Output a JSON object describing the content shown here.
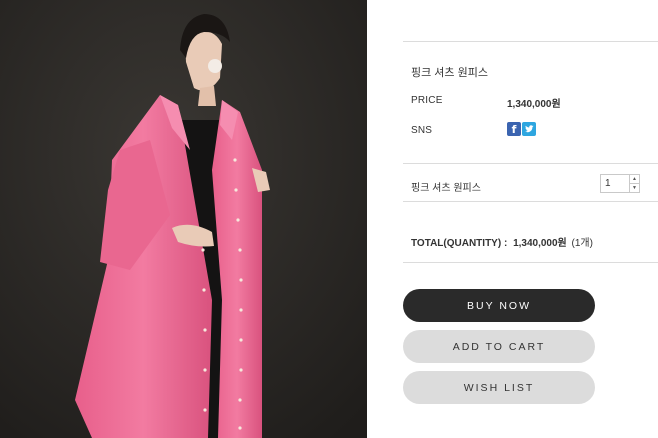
{
  "product": {
    "name": "핑크 셔츠 원피스",
    "price_label": "PRICE",
    "price_value": "1,340,000원",
    "sns_label": "SNS",
    "sns_icons": [
      "facebook-icon",
      "twitter-icon"
    ]
  },
  "option": {
    "name": "핑크 셔츠 원피스",
    "quantity": "1"
  },
  "total": {
    "label": "TOTAL(QUANTITY) :",
    "amount": "1,340,000원",
    "count": "(1개)"
  },
  "buttons": {
    "buy_now": "BUY NOW",
    "add_to_cart": "ADD TO CART",
    "wish_list": "WISH LIST"
  },
  "colors": {
    "buy_button": "#2a2a2a",
    "secondary_button": "#dcdcdc",
    "photo_background": "#2b2926",
    "dress": "#ef6f98"
  }
}
